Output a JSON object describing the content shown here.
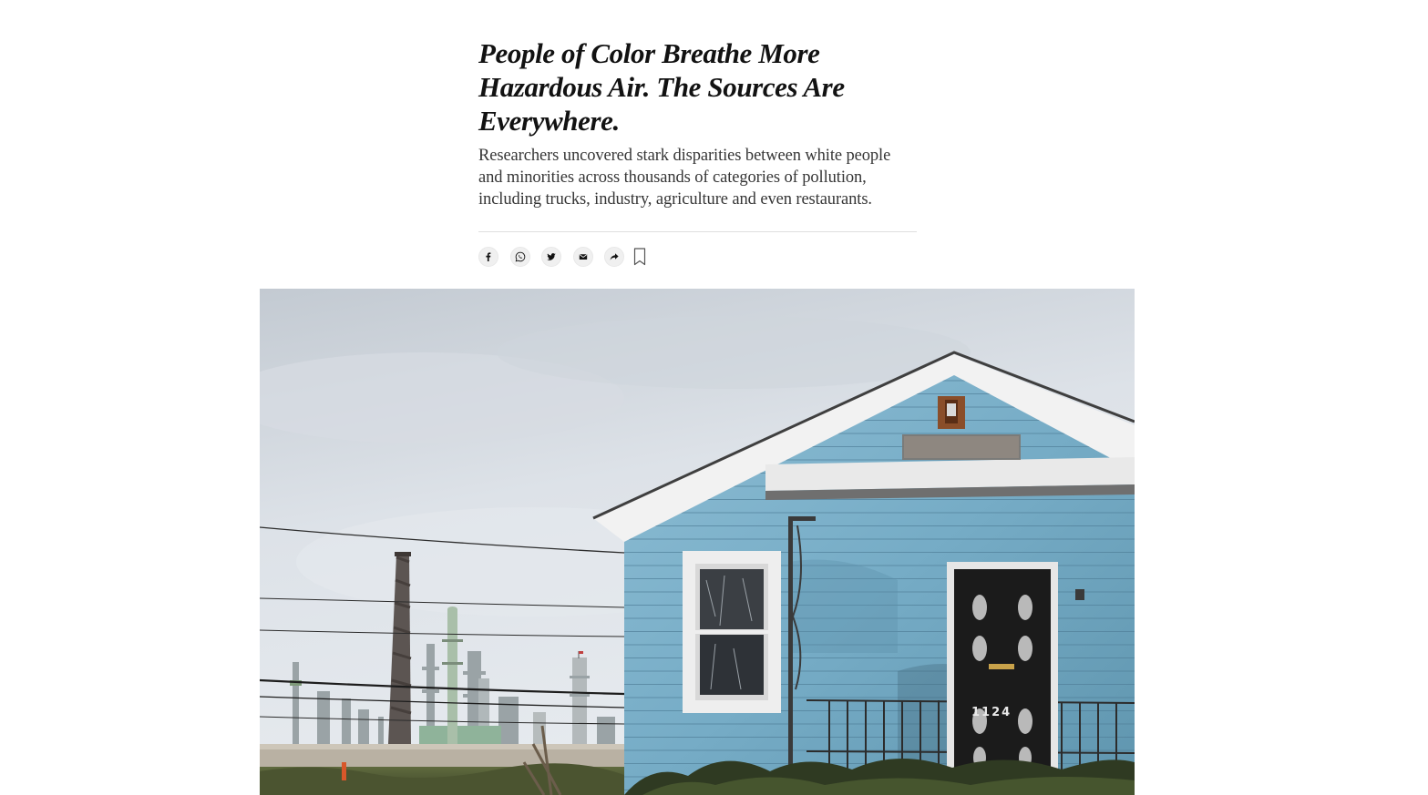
{
  "article": {
    "headline": "People of Color Breathe More Hazardous Air. The Sources Are Everywhere.",
    "summary": "Researchers uncovered stark disparities between white people and minorities across thousands of categories of pollution, including trucks, industry, agriculture and even restaurants."
  },
  "share_bar": {
    "buttons": [
      {
        "icon": "facebook-icon"
      },
      {
        "icon": "whatsapp-icon"
      },
      {
        "icon": "twitter-icon"
      },
      {
        "icon": "email-icon"
      },
      {
        "icon": "share-arrow-icon"
      },
      {
        "icon": "bookmark-icon"
      }
    ]
  },
  "hero_image": {
    "house_number": "1124"
  },
  "colors": {
    "text": "#121212",
    "summary_text": "#363636",
    "divider": "#dfdfdf",
    "icon_bg": "#f0f0f0",
    "house_siding": "#7fb3cc"
  }
}
